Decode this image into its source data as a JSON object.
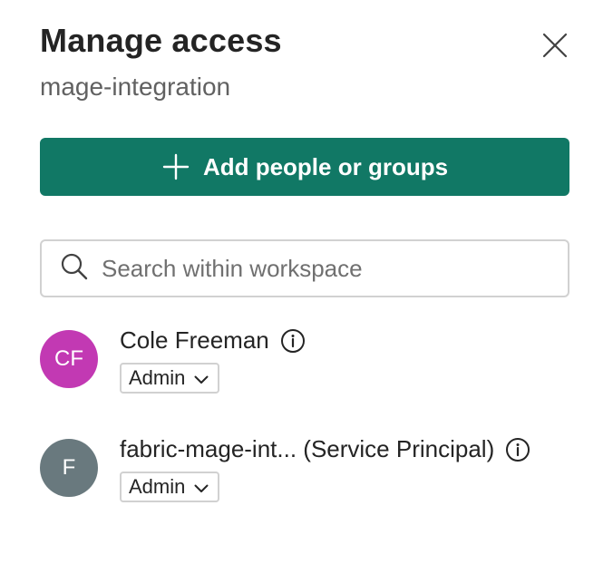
{
  "header": {
    "title": "Manage access",
    "subtitle": "mage-integration"
  },
  "actions": {
    "add_label": "Add people or groups"
  },
  "search": {
    "placeholder": "Search within workspace"
  },
  "members": [
    {
      "initials": "CF",
      "name": "Cole Freeman",
      "role": "Admin",
      "avatar_color": "#c239b3"
    },
    {
      "initials": "F",
      "name": "fabric-mage-int... (Service Principal)",
      "role": "Admin",
      "avatar_color": "#69797e"
    }
  ],
  "colors": {
    "primary": "#117865"
  },
  "icons": [
    "close-icon",
    "plus-icon",
    "search-icon",
    "info-icon",
    "chevron-down-icon"
  ]
}
